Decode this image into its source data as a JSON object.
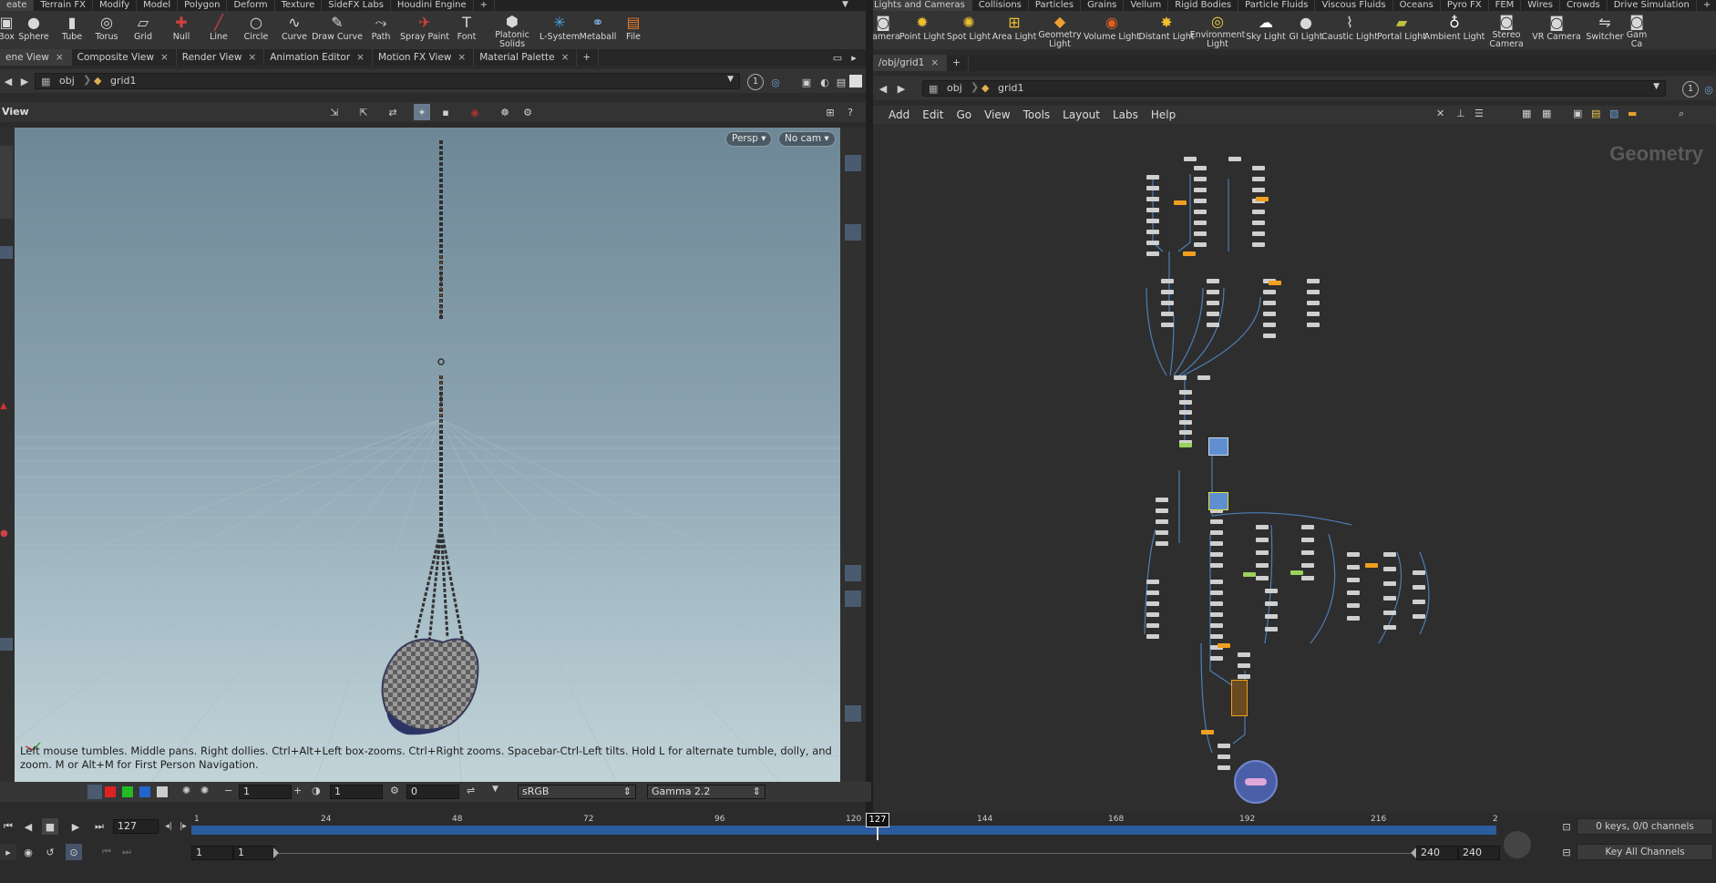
{
  "left_shelf": {
    "tabs": [
      "eate",
      "Terrain FX",
      "Modify",
      "Model",
      "Polygon",
      "Deform",
      "Texture",
      "SideFX Labs",
      "Houdini Engine",
      "+"
    ],
    "tools": [
      {
        "label": "Box",
        "icon": "box-icon"
      },
      {
        "label": "Sphere",
        "icon": "sphere-icon"
      },
      {
        "label": "Tube",
        "icon": "tube-icon"
      },
      {
        "label": "Torus",
        "icon": "torus-icon"
      },
      {
        "label": "Grid",
        "icon": "grid-icon"
      },
      {
        "label": "Null",
        "icon": "null-icon"
      },
      {
        "label": "Line",
        "icon": "line-icon"
      },
      {
        "label": "Circle",
        "icon": "circle-icon"
      },
      {
        "label": "Curve",
        "icon": "curve-icon"
      },
      {
        "label": "Draw Curve",
        "icon": "draw-curve-icon"
      },
      {
        "label": "Path",
        "icon": "path-icon"
      },
      {
        "label": "Spray Paint",
        "icon": "spray-paint-icon"
      },
      {
        "label": "Font",
        "icon": "font-icon"
      },
      {
        "label": "Platonic\nSolids",
        "icon": "platonic-icon"
      },
      {
        "label": "L-System",
        "icon": "lsystem-icon"
      },
      {
        "label": "Metaball",
        "icon": "metaball-icon"
      },
      {
        "label": "File",
        "icon": "file-icon"
      }
    ]
  },
  "right_shelf": {
    "tabs": [
      "Lights and Cameras",
      "Collisions",
      "Particles",
      "Grains",
      "Vellum",
      "Rigid Bodies",
      "Particle Fluids",
      "Viscous Fluids",
      "Oceans",
      "Pyro FX",
      "FEM",
      "Wires",
      "Crowds",
      "Drive Simulation",
      "+"
    ],
    "tools": [
      {
        "label": "Camera",
        "icon": "camera-icon"
      },
      {
        "label": "Point Light",
        "icon": "point-light-icon"
      },
      {
        "label": "Spot Light",
        "icon": "spot-light-icon"
      },
      {
        "label": "Area Light",
        "icon": "area-light-icon"
      },
      {
        "label": "Geometry\nLight",
        "icon": "geometry-light-icon"
      },
      {
        "label": "Volume Light",
        "icon": "volume-light-icon"
      },
      {
        "label": "Distant Light",
        "icon": "distant-light-icon"
      },
      {
        "label": "Environment\nLight",
        "icon": "environment-light-icon"
      },
      {
        "label": "Sky Light",
        "icon": "sky-light-icon"
      },
      {
        "label": "GI Light",
        "icon": "gi-light-icon"
      },
      {
        "label": "Caustic Light",
        "icon": "caustic-light-icon"
      },
      {
        "label": "Portal Light",
        "icon": "portal-light-icon"
      },
      {
        "label": "Ambient Light",
        "icon": "ambient-light-icon"
      },
      {
        "label": "Stereo\nCamera",
        "icon": "stereo-camera-icon"
      },
      {
        "label": "VR Camera",
        "icon": "vr-camera-icon"
      },
      {
        "label": "Switcher",
        "icon": "switcher-icon"
      },
      {
        "label": "Gam\nCa",
        "icon": "gamepad-camera-icon"
      }
    ]
  },
  "left_pane": {
    "tabs": [
      "ene View",
      "Composite View",
      "Render View",
      "Animation Editor",
      "Motion FX View",
      "Material Palette"
    ],
    "path": {
      "root": "obj",
      "node": "grid1"
    },
    "badge": "1",
    "view_title": "View",
    "persp_label": "Persp ▾",
    "cam_label": "No cam ▾",
    "status_text": "Left mouse tumbles. Middle pans. Right dollies. Ctrl+Alt+Left box-zooms. Ctrl+Right zooms. Spacebar-Ctrl-Left tilts. Hold L for alternate tumble, dolly, and zoom.     M or Alt+M for First Person Navigation.",
    "bottom": {
      "field1": "1",
      "field2": "1",
      "field3": "0",
      "colorspace": "sRGB",
      "gamma": "Gamma 2.2"
    }
  },
  "right_pane": {
    "tab": "/obj/grid1",
    "path": {
      "root": "obj",
      "node": "grid1"
    },
    "badge": "1",
    "menu": [
      "Add",
      "Edit",
      "Go",
      "View",
      "Tools",
      "Layout",
      "Labs",
      "Help"
    ],
    "context_label": "Geometry"
  },
  "timeline": {
    "current_frame": "127",
    "marker": "127",
    "ticks": [
      "1",
      "24",
      "48",
      "72",
      "96",
      "120",
      "144",
      "168",
      "192",
      "216",
      "2"
    ],
    "start": "1",
    "start2": "1",
    "end": "240",
    "end2": "240",
    "keys_label": "0 keys, 0/0 channels",
    "key_all_label": "Key All Channels"
  }
}
